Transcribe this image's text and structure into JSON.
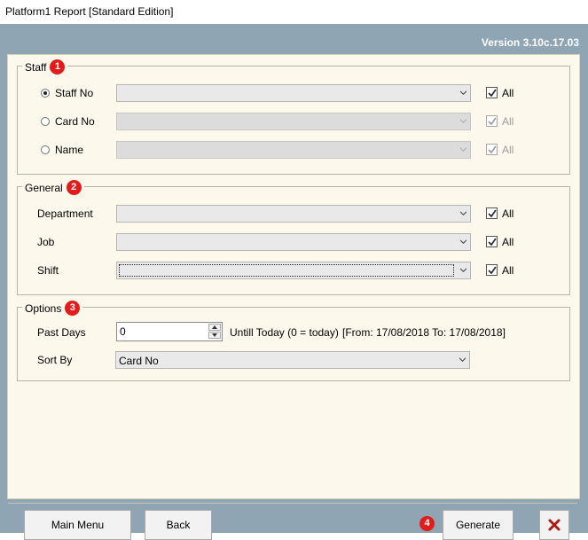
{
  "window": {
    "title": "Platform1 Report [Standard Edition]",
    "version": "Version 3.10c.17.03"
  },
  "staff": {
    "legend": "Staff",
    "badge": "1",
    "rows": [
      {
        "label": "Staff No",
        "selected": true,
        "enabled": true,
        "all_label": "All"
      },
      {
        "label": "Card No",
        "selected": false,
        "enabled": false,
        "all_label": "All"
      },
      {
        "label": "Name",
        "selected": false,
        "enabled": false,
        "all_label": "All"
      }
    ]
  },
  "general": {
    "legend": "General",
    "badge": "2",
    "rows": [
      {
        "label": "Department",
        "all_label": "All"
      },
      {
        "label": "Job",
        "all_label": "All"
      },
      {
        "label": "Shift",
        "all_label": "All"
      }
    ]
  },
  "options": {
    "legend": "Options",
    "badge": "3",
    "past_days_label": "Past Days",
    "past_days_value": "0",
    "until_text": "Untill Today (0 = today)",
    "range_text": "[From: 17/08/2018 To: 17/08/2018]",
    "sort_by_label": "Sort By",
    "sort_by_value": "Card No"
  },
  "footer": {
    "main_menu": "Main Menu",
    "back": "Back",
    "generate": "Generate",
    "generate_badge": "4"
  },
  "colors": {
    "frame": "#8fa5b4",
    "panel": "#fcf8ec",
    "badge": "#e21b1b",
    "close_x": "#b01818"
  }
}
